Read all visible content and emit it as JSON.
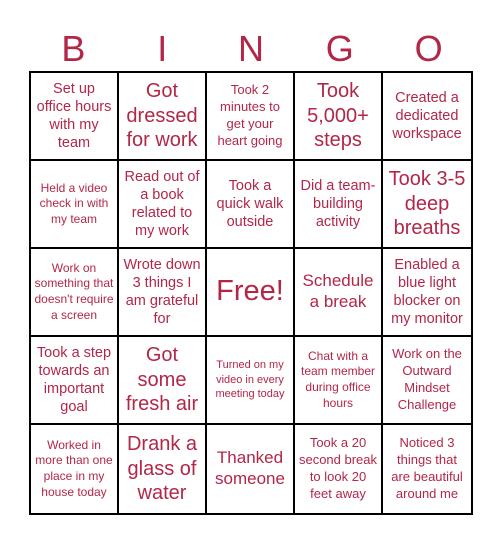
{
  "header": {
    "letters": [
      "B",
      "I",
      "N",
      "G",
      "O"
    ]
  },
  "theme": {
    "text_color": "#b22748",
    "grid_color": "#000000"
  },
  "board": {
    "rows": [
      [
        "Set up office hours with my team",
        "Got dressed for work",
        "Took 2 minutes to get your heart going",
        "Took 5,000+ steps",
        "Created a dedicated workspace"
      ],
      [
        "Held a video check in with my team",
        "Read out of a book related to my work",
        "Took a quick walk outside",
        "Did a team-building activity",
        "Took 3-5 deep breaths"
      ],
      [
        "Work on something that doesn't require a screen",
        "Wrote down 3 things I am grateful for",
        "Free!",
        "Schedule a break",
        "Enabled a blue light blocker on my monitor"
      ],
      [
        "Took a step towards an important goal",
        "Got some fresh air",
        "Turned on my video in every meeting today",
        "Chat with a team member during office hours",
        "Work on the Outward Mindset Challenge"
      ],
      [
        "Worked in more than one place in my house today",
        "Drank a glass of water",
        "Thanked someone",
        "Took a 20 second break to look 20 feet away",
        "Noticed 3 things that are beautiful around me"
      ]
    ]
  }
}
